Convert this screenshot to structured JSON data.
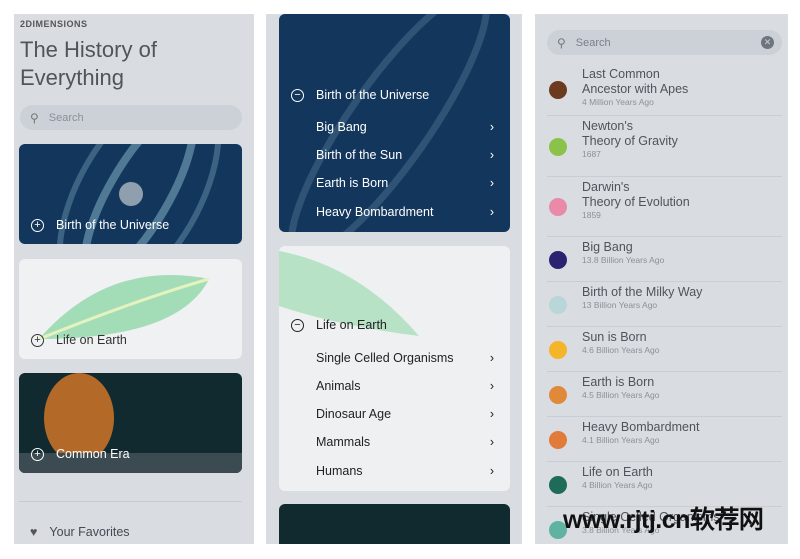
{
  "left": {
    "brand": "2DIMENSIONS",
    "title": "The History of Everything",
    "search_placeholder": "Search",
    "cards": [
      {
        "label": "Birth of the Universe"
      },
      {
        "label": "Life on Earth"
      },
      {
        "label": "Common Era"
      }
    ],
    "favorites": "Your Favorites"
  },
  "middle": {
    "sections": [
      {
        "title": "Birth of the Universe",
        "items": [
          "Big Bang",
          "Birth of the Sun",
          "Earth is Born",
          "Heavy Bombardment"
        ]
      },
      {
        "title": "Life on Earth",
        "items": [
          "Single Celled Organisms",
          "Animals",
          "Dinosaur Age",
          "Mammals",
          "Humans"
        ]
      }
    ]
  },
  "right": {
    "search_value": "Search",
    "results": [
      {
        "l1": "Last Common",
        "l2": "Ancestor with Apes",
        "sub": "4 Million Years Ago",
        "color": "#6b3a1f"
      },
      {
        "l1": "Newton's",
        "l2": "Theory of Gravity",
        "sub": "1687",
        "color": "#8bc34a"
      },
      {
        "l1": "Darwin's",
        "l2": "Theory of Evolution",
        "sub": "1859",
        "color": "#e88aa8"
      },
      {
        "l1": "Big Bang",
        "sub": "13.8 Billion Years Ago",
        "color": "#2a2470"
      },
      {
        "l1": "Birth of the Milky Way",
        "sub": "13 Billion Years Ago",
        "color": "#b9d6d8"
      },
      {
        "l1": "Sun is Born",
        "sub": "4.6 Billion Years Ago",
        "color": "#f4b52a"
      },
      {
        "l1": "Earth is Born",
        "sub": "4.5 Billion Years Ago",
        "color": "#e0893a"
      },
      {
        "l1": "Heavy Bombardment",
        "sub": "4.1 Billion Years Ago",
        "color": "#e07b3a"
      },
      {
        "l1": "Life on Earth",
        "sub": "4 Billion Years Ago",
        "color": "#1f6b5a"
      },
      {
        "l1": "Single Celled Organisms",
        "sub": "3.8 Billion Years Ago",
        "color": "#5fb3a0"
      }
    ]
  },
  "watermark": "www.rjtj.cn软荐网"
}
